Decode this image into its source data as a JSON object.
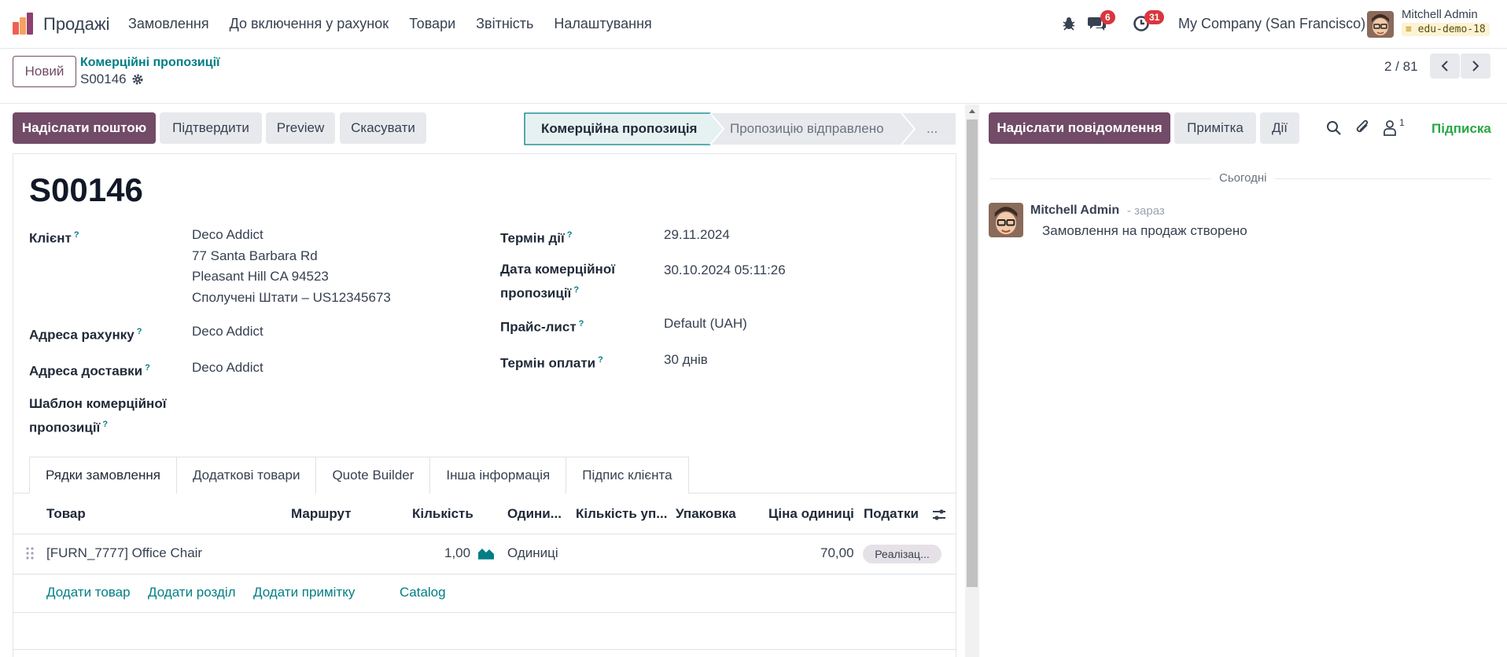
{
  "navbar": {
    "app_name": "Продажі",
    "menu": [
      "Замовлення",
      "До включення у рахунок",
      "Товари",
      "Звітність",
      "Налаштування"
    ],
    "messages_count": "6",
    "activities_count": "31",
    "company": "My Company (San Francisco)",
    "user_name": "Mitchell Admin",
    "database": "edu-demo-18"
  },
  "control": {
    "new_label": "Новий",
    "breadcrumb": "Комерційні пропозиції",
    "record": "S00146",
    "pager": "2 / 81"
  },
  "actions": {
    "send_email": "Надіслати поштою",
    "confirm": "Підтвердити",
    "preview": "Preview",
    "cancel": "Скасувати"
  },
  "statusbar": {
    "stages": [
      "Комерційна пропозиція",
      "Пропозицію відправлено",
      "..."
    ],
    "active_index": 0
  },
  "form": {
    "title": "S00146",
    "customer_label": "Клієнт",
    "customer_lines": [
      "Deco Addict",
      "77 Santa Barbara Rd",
      "Pleasant Hill CA 94523",
      "Сполучені Штати – US12345673"
    ],
    "invoice_address_label": "Адреса рахунку",
    "invoice_address": "Deco Addict",
    "delivery_address_label": "Адреса доставки",
    "delivery_address": "Deco Addict",
    "template_label_1": "Шаблон комерційної",
    "template_label_2": "пропозиції",
    "validity_label": "Термін дії",
    "validity": "29.11.2024",
    "quote_date_label_1": "Дата комерційної",
    "quote_date_label_2": "пропозиції",
    "quote_date": "30.10.2024 05:11:26",
    "pricelist_label": "Прайс-лист",
    "pricelist": "Default (UAH)",
    "payment_terms_label": "Термін оплати",
    "payment_terms": "30 днів",
    "help_mark": "?"
  },
  "tabs": [
    "Рядки замовлення",
    "Додаткові товари",
    "Quote Builder",
    "Інша інформація",
    "Підпис клієнта"
  ],
  "table": {
    "headers": [
      "Товар",
      "Маршрут",
      "Кількість",
      "Одини...",
      "Кількість уп...",
      "Упаковка",
      "Ціна одиниці",
      "Податки"
    ],
    "row": {
      "product": "[FURN_7777] Office Chair",
      "quantity": "1,00",
      "uom": "Одиниці",
      "price": "70,00",
      "tax": "Реалізац..."
    },
    "links": [
      "Додати товар",
      "Додати розділ",
      "Додати примітку",
      "Catalog"
    ]
  },
  "chatter": {
    "send_message": "Надіслати повідомлення",
    "note": "Примітка",
    "activities": "Дії",
    "followers_count": "1",
    "follow": "Підписка",
    "today": "Сьогодні",
    "author": "Mitchell Admin",
    "time": "- зараз",
    "body": "Замовлення на продаж створено"
  },
  "colors": {
    "brand": "#714b67",
    "link": "#017e84",
    "badge": "#d9363e",
    "follow": "#28a745"
  }
}
